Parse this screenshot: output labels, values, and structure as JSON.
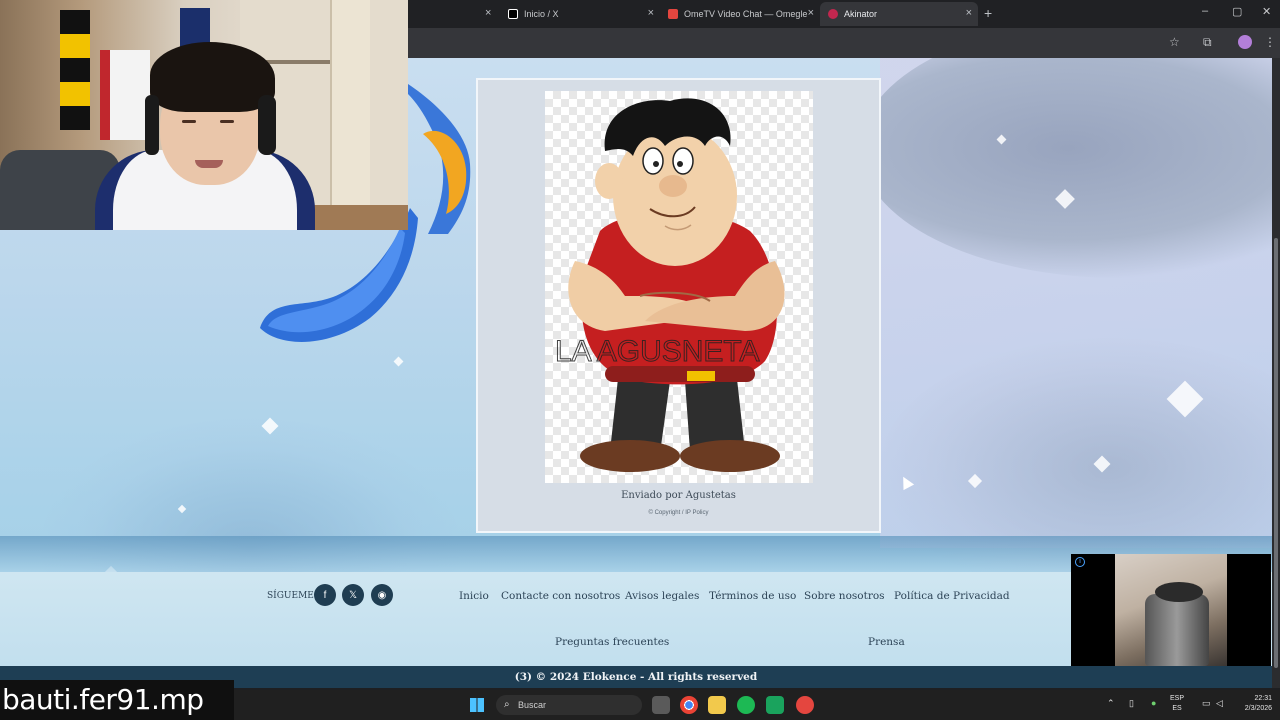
{
  "browser": {
    "tabs": [
      {
        "label": "Inicio / X",
        "favicon_color": "#ffffff"
      },
      {
        "label": "OmeTV Video Chat — Omegle",
        "favicon_color": "#e4463f"
      },
      {
        "label": "Akinator",
        "favicon_color": "#c2274f"
      }
    ],
    "close_glyph": "×",
    "new_tab_glyph": "+",
    "window_controls": [
      "–",
      "▢",
      "✕"
    ],
    "toolbar_icons": [
      "star-icon",
      "extensions-icon",
      "profile-icon",
      "menu-icon"
    ]
  },
  "page": {
    "card": {
      "watermark": "LA AGUSNETA",
      "caption": "Enviado por Agustetas",
      "copyright": "© Copyright / IP Policy"
    },
    "footer": {
      "follow_label": "SÍGUEME",
      "social": [
        {
          "name": "facebook-icon",
          "glyph": "f"
        },
        {
          "name": "x-icon",
          "glyph": "𝕏"
        },
        {
          "name": "discord-icon",
          "glyph": "◉"
        }
      ],
      "links": [
        "Inicio",
        "Contacte con nosotros",
        "Avisos legales",
        "Términos de uso",
        "Sobre nosotros",
        "Política de Privacidad"
      ],
      "links_row2": [
        "Preguntas frecuentes",
        "Prensa"
      ],
      "copyright_bar": "(3)  © 2024 Elokence - All rights reserved"
    }
  },
  "overlay": {
    "stream_username": "bauti.fer91.mp"
  },
  "taskbar": {
    "search_placeholder": "Buscar",
    "lang_line1": "ESP",
    "lang_line2": "ES",
    "time": "22:31",
    "date": "2/3/2026"
  }
}
